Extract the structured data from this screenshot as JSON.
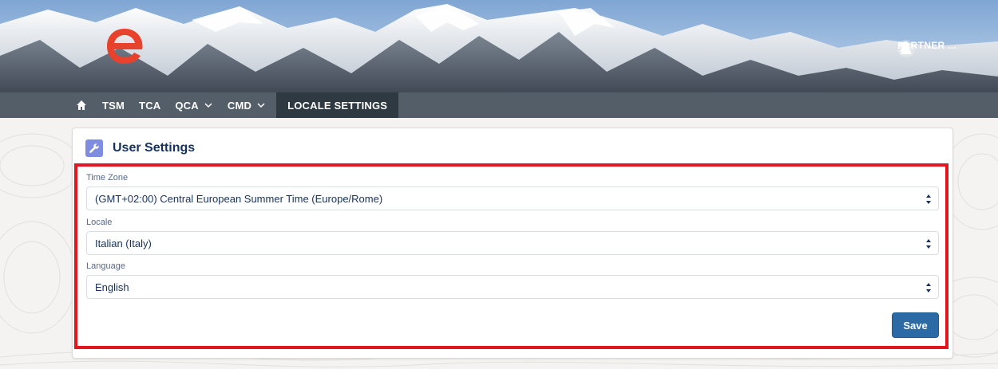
{
  "header": {
    "user_name": "PARTNER ..."
  },
  "nav": {
    "items": [
      {
        "label": "TSM"
      },
      {
        "label": "TCA"
      },
      {
        "label": "QCA"
      },
      {
        "label": "CMD"
      },
      {
        "label": "LOCALE SETTINGS"
      }
    ],
    "active": "LOCALE SETTINGS"
  },
  "card": {
    "title": "User Settings",
    "fields": [
      {
        "label": "Time Zone",
        "value": "(GMT+02:00) Central European Summer Time (Europe/Rome)"
      },
      {
        "label": "Locale",
        "value": "Italian (Italy)"
      },
      {
        "label": "Language",
        "value": "English"
      }
    ],
    "save_label": "Save"
  },
  "colors": {
    "navbar": "#46525e",
    "accent_button": "#2c6aa6",
    "highlight_border": "#e2161e",
    "logo": "#e8412c",
    "settings_icon_bg": "#7f8de1"
  },
  "icons": {
    "home": "home-icon",
    "chevron": "chevron-down-icon",
    "bell": "bell-icon",
    "user": "user-avatar-icon",
    "wrench": "wrench-icon",
    "select_arrows": "select-arrows-icon"
  }
}
